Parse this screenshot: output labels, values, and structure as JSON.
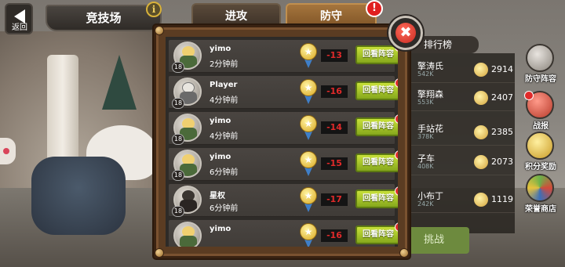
{
  "header": {
    "back_label": "返回",
    "arena_title": "竞技场",
    "info_glyph": "i"
  },
  "tabs": [
    {
      "label": "进攻",
      "active": false
    },
    {
      "label": "防守",
      "active": true
    }
  ],
  "tab_alert": "!",
  "close_glyph": "✖",
  "battles": [
    {
      "name": "yimo",
      "time": "2分钟前",
      "level": "18",
      "score": "-13",
      "button": "回看阵容",
      "avatar": "green-warrior"
    },
    {
      "name": "Player",
      "time": "4分钟前",
      "level": "18",
      "score": "-16",
      "button": "回看阵容",
      "avatar": "white-knight"
    },
    {
      "name": "yimo",
      "time": "4分钟前",
      "level": "18",
      "score": "-14",
      "button": "回看阵容",
      "avatar": "green-warrior"
    },
    {
      "name": "yimo",
      "time": "6分钟前",
      "level": "18",
      "score": "-15",
      "button": "回看阵容",
      "avatar": "green-warrior"
    },
    {
      "name": "星权",
      "time": "6分钟前",
      "level": "18",
      "score": "-17",
      "button": "回看阵容",
      "avatar": "dark-warrior"
    },
    {
      "name": "yimo",
      "time": "",
      "level": "",
      "score": "-16",
      "button": "回看阵容",
      "avatar": "green-warrior"
    }
  ],
  "button_alert": "!",
  "medal_glyph": "★",
  "background": {
    "rank_header": "排行榜",
    "rank_rows": [
      {
        "name": "擎涛氏",
        "sub": "542K",
        "score": "2914"
      },
      {
        "name": "擎翔森",
        "sub": "553K",
        "score": "2407"
      },
      {
        "name": "手站花",
        "sub": "378K",
        "score": "2385"
      },
      {
        "name": "子车",
        "sub": "408K",
        "score": "2073"
      },
      {
        "name": "小布丁",
        "sub": "242K",
        "score": "1119"
      }
    ],
    "challenge_label": "挑战"
  },
  "side_menu": [
    {
      "label": "防守阵容",
      "icon": "shield-icon"
    },
    {
      "label": "战报",
      "icon": "battle-report-icon"
    },
    {
      "label": "积分奖励",
      "icon": "points-reward-icon"
    },
    {
      "label": "荣誉商店",
      "icon": "honor-shop-icon"
    }
  ],
  "colors": {
    "score_red": "#e02a2a",
    "button_green": "#a6c42a",
    "frame_brown": "#5b3c22",
    "active_tab": "#a5753d"
  }
}
